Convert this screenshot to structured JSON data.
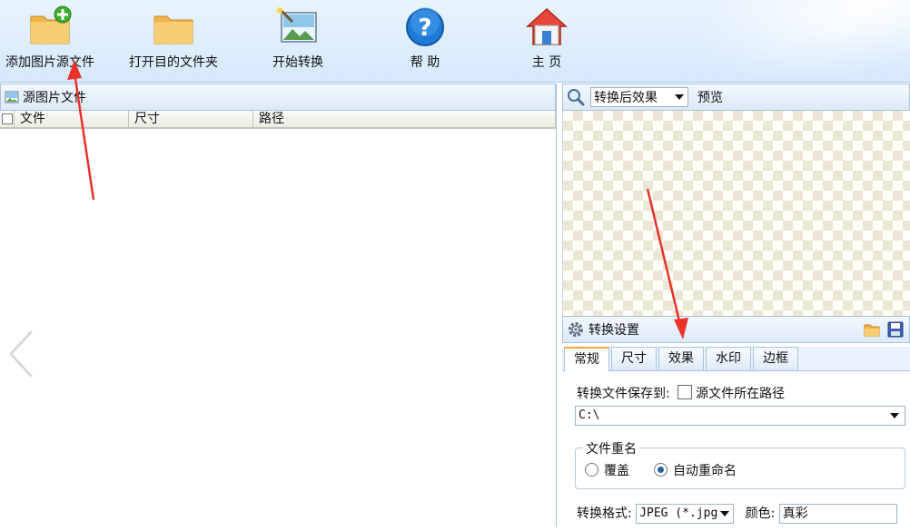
{
  "toolbar": {
    "add_source": "添加图片源文件",
    "open_dest": "打开目的文件夹",
    "start_convert": "开始转换",
    "help": "帮 助",
    "home": "主 页"
  },
  "source_panel": {
    "title": "源图片文件",
    "columns": [
      "文件",
      "尺寸",
      "路径"
    ]
  },
  "preview_panel": {
    "mode_selected": "转换后效果",
    "preview_label": "预览"
  },
  "settings_panel": {
    "title": "转换设置",
    "tabs": [
      "常规",
      "尺寸",
      "效果",
      "水印",
      "边框"
    ],
    "active_tab": "常规",
    "save_to_label": "转换文件保存到:",
    "source_path_checkbox_label": "源文件所在路径",
    "source_path_checked": false,
    "save_path": "C:\\",
    "rename_group": "文件重名",
    "rename_options": [
      "覆盖",
      "自动重命名"
    ],
    "rename_selected": "自动重命名",
    "format_label": "转换格式:",
    "format_value": "JPEG (*.jpg",
    "color_label": "颜色:",
    "color_value": "真彩"
  },
  "colors": {
    "annotation_arrow": "#e8322a",
    "active_tab_accent": "#f0a53c"
  }
}
